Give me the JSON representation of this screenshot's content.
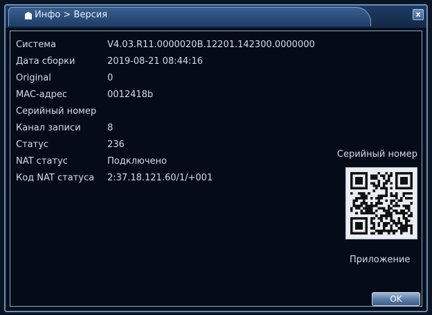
{
  "window": {
    "title": "Инфо > Версия",
    "close_label": "x"
  },
  "info": [
    {
      "label": "Система",
      "value": "V4.03.R11.0000020B.12201.142300.0000000"
    },
    {
      "label": "Дата сборки",
      "value": "2019-08-21 08:44:16"
    },
    {
      "label": "Original",
      "value": "0"
    },
    {
      "label": "MAC-адрес",
      "value": "0012418b"
    },
    {
      "label": "Серийный номер",
      "value": ""
    },
    {
      "label": "Канал записи",
      "value": "8"
    },
    {
      "label": "Статус",
      "value": "236"
    },
    {
      "label": "NAT статус",
      "value": "Подключено"
    },
    {
      "label": "Код NAT статуса",
      "value": "2:37.18.121.60/1/+001"
    }
  ],
  "qr": {
    "caption_top": "Серийный номер",
    "caption_bottom": "Приложение"
  },
  "buttons": {
    "ok_label": "OK"
  },
  "colors": {
    "background": "#07101e",
    "title_bar": "#1f3d66",
    "text": "#d6dde8",
    "border": "#8fa8c4"
  }
}
